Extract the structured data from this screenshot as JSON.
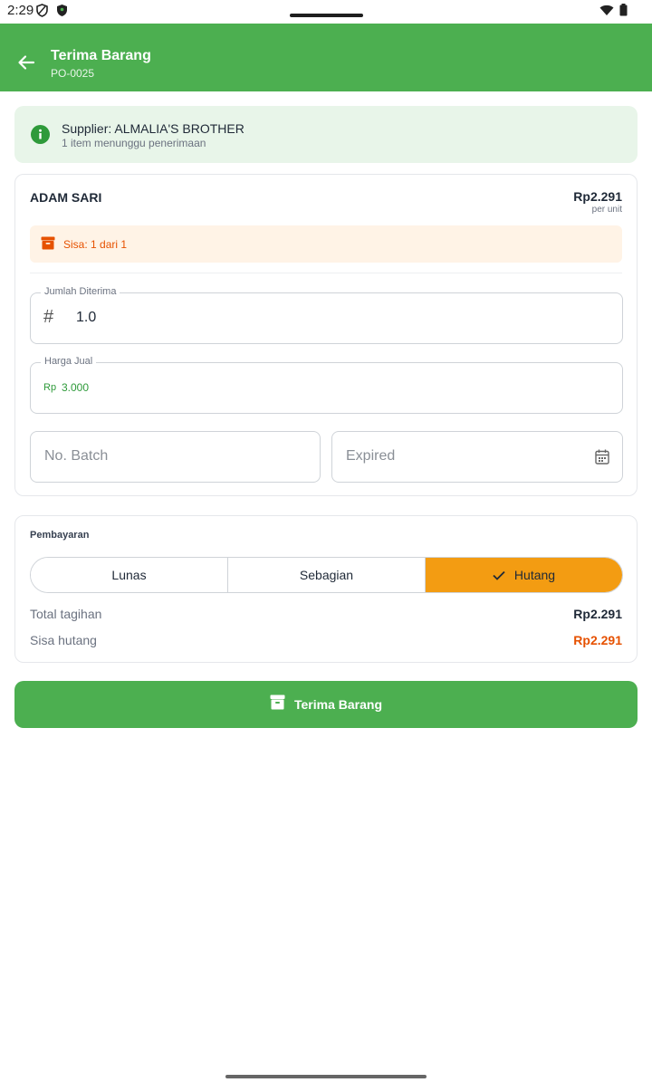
{
  "status_bar": {
    "time": "2:29"
  },
  "header": {
    "title": "Terima Barang",
    "subtitle": "PO-0025"
  },
  "info": {
    "supplier": "Supplier: ALMALIA'S BROTHER",
    "pending": "1 item menunggu penerimaan"
  },
  "item": {
    "name": "ADAM SARI",
    "price": "Rp2.291",
    "price_unit": "per unit",
    "remaining": "Sisa: 1 dari 1",
    "qty_label": "Jumlah Diterima",
    "qty_value": "1.0",
    "sell_label": "Harga Jual",
    "sell_prefix": "Rp",
    "sell_value": "3.000",
    "batch_placeholder": "No. Batch",
    "expired_placeholder": "Expired"
  },
  "payment": {
    "title": "Pembayaran",
    "options": [
      "Lunas",
      "Sebagian",
      "Hutang"
    ],
    "selected": "Hutang",
    "total_label": "Total tagihan",
    "total_value": "Rp2.291",
    "debt_label": "Sisa hutang",
    "debt_value": "Rp2.291"
  },
  "submit_label": "Terima Barang",
  "colors": {
    "primary": "#4caf50",
    "accent": "#f39c12",
    "warning": "#e65100",
    "info_bg": "#e8f5e9",
    "warning_bg": "#fff3e6"
  }
}
